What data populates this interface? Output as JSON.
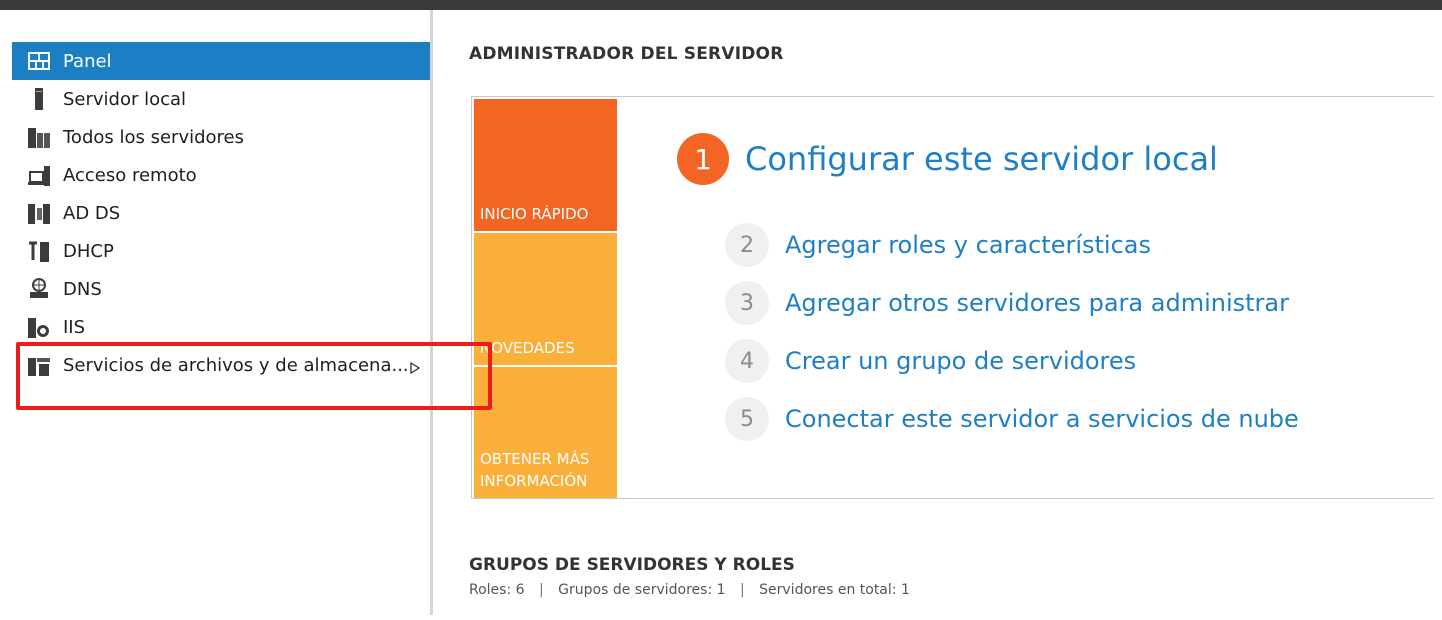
{
  "sidebar": {
    "items": [
      {
        "label": "Panel",
        "icon": "dashboard-icon",
        "active": true
      },
      {
        "label": "Servidor local",
        "icon": "server-icon"
      },
      {
        "label": "Todos los servidores",
        "icon": "servers-icon"
      },
      {
        "label": "Acceso remoto",
        "icon": "remote-access-icon"
      },
      {
        "label": "AD DS",
        "icon": "ad-ds-icon"
      },
      {
        "label": "DHCP",
        "icon": "dhcp-icon"
      },
      {
        "label": "DNS",
        "icon": "dns-icon"
      },
      {
        "label": "IIS",
        "icon": "iis-icon"
      },
      {
        "label": "Servicios de archivos y de almacena...",
        "icon": "file-storage-icon",
        "has_submenu": true
      }
    ]
  },
  "main": {
    "title": "ADMINISTRADOR DEL SERVIDOR",
    "quick_start": {
      "tiles": [
        {
          "label": "INICIO RÁPIDO"
        },
        {
          "label": "NOVEDADES"
        },
        {
          "label_line1": "OBTENER MÁS",
          "label_line2": "INFORMACIÓN"
        }
      ],
      "steps": [
        {
          "num": "1",
          "text": "Configurar este servidor local"
        },
        {
          "num": "2",
          "text": "Agregar roles y características"
        },
        {
          "num": "3",
          "text": "Agregar otros servidores para administrar"
        },
        {
          "num": "4",
          "text": "Crear un grupo de servidores"
        },
        {
          "num": "5",
          "text": "Conectar este servidor a servicios de nube"
        }
      ]
    },
    "groups": {
      "title": "GRUPOS DE SERVIDORES Y ROLES",
      "roles": "Roles: 6",
      "server_groups": "Grupos de servidores: 1",
      "total_servers": "Servidores en total: 1",
      "separator": "|"
    }
  },
  "colors": {
    "active_nav": "#1c7fc3",
    "tile_primary": "#f26522",
    "tile_secondary": "#fbaf3b",
    "link": "#1f7fc4",
    "highlight": "#ee1c1c"
  }
}
